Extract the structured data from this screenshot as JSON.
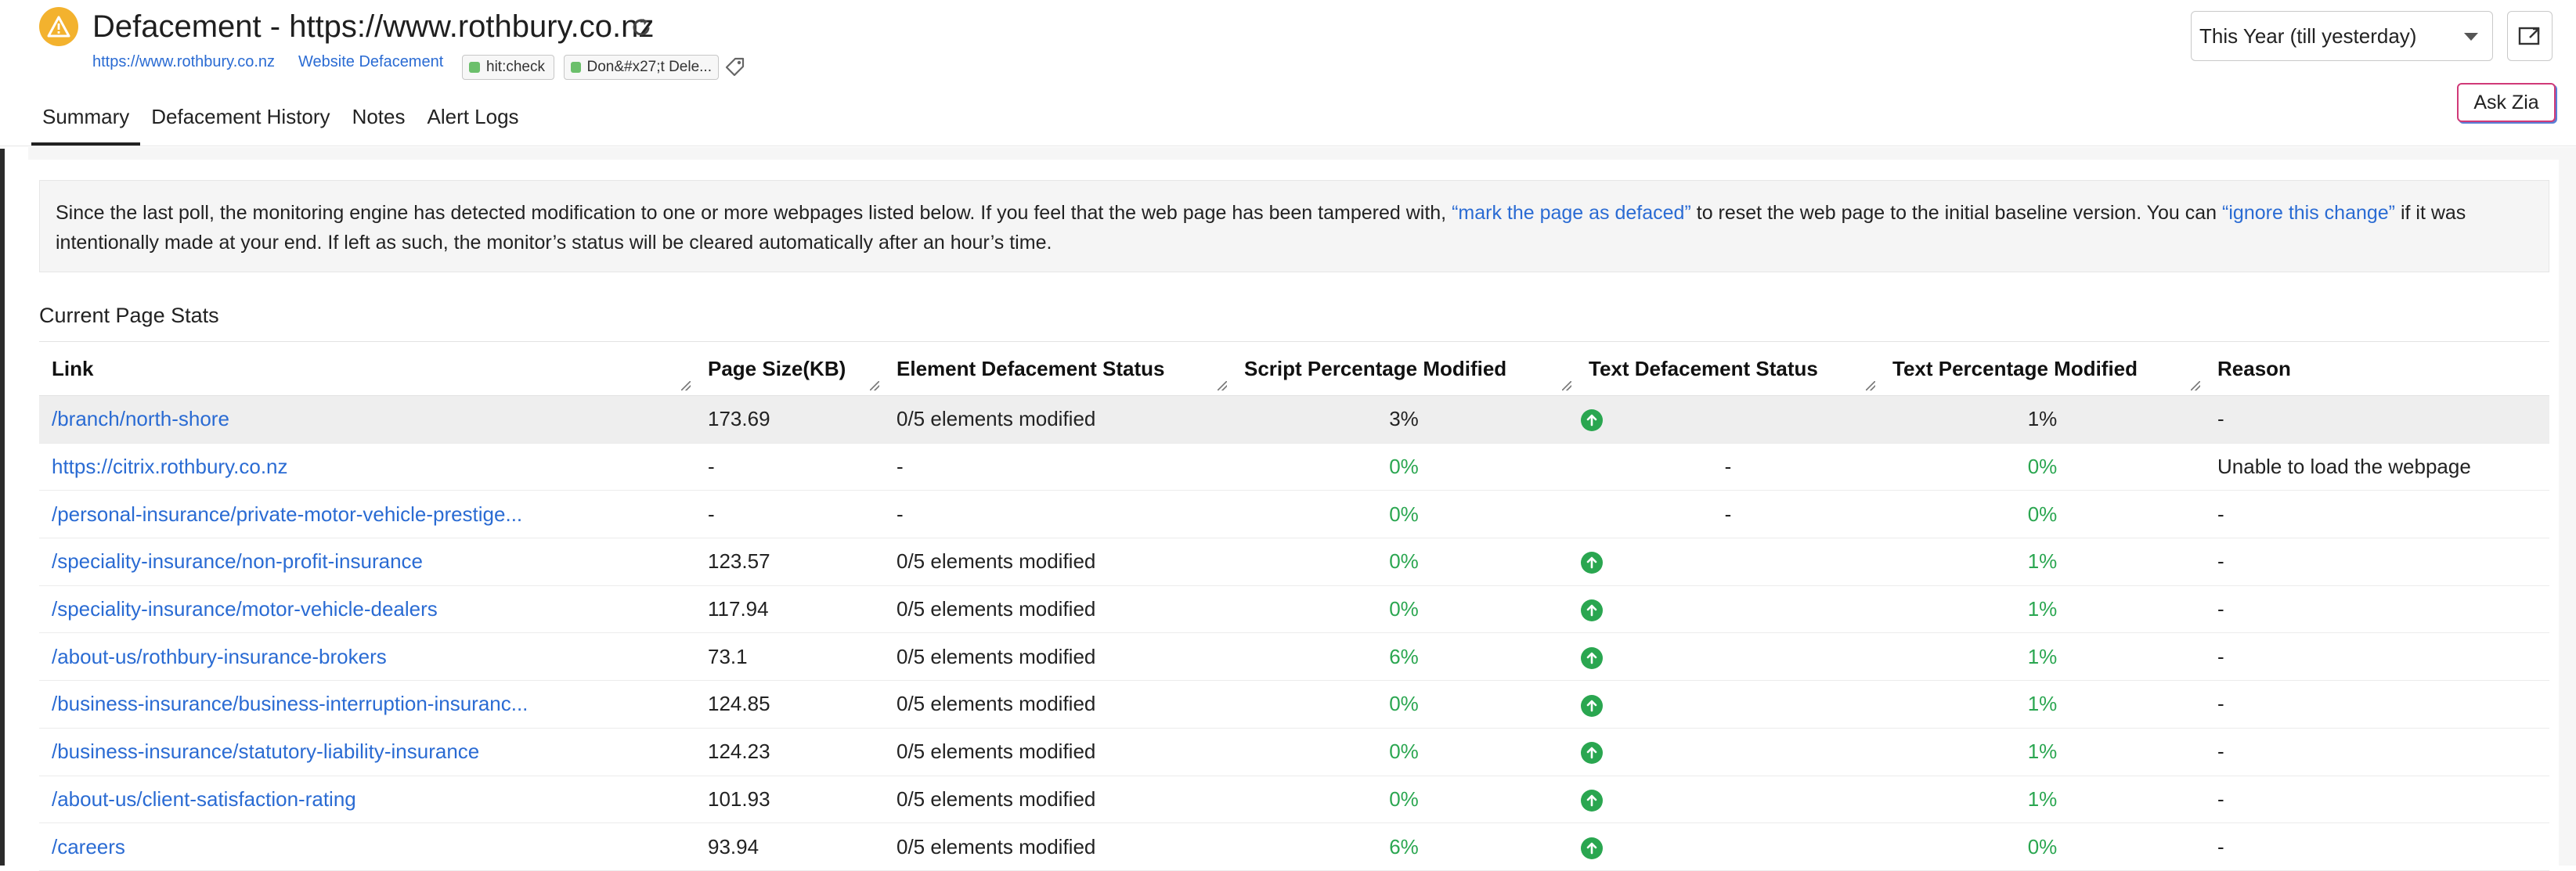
{
  "header": {
    "title": "Defacement - https://www.rothbury.co.nz",
    "url_link": "https://www.rothbury.co.nz",
    "type_link": "Website Defacement",
    "tags": [
      "hit:check",
      "Don&#x27;t Dele..."
    ]
  },
  "tabs": [
    {
      "label": "Summary"
    },
    {
      "label": "Defacement History"
    },
    {
      "label": "Notes"
    },
    {
      "label": "Alert Logs"
    }
  ],
  "controls": {
    "period": "This Year (till yesterday)",
    "ask_zia": "Ask Zia"
  },
  "notice": {
    "part1": "Since the last poll, the monitoring engine has detected modification to one or more webpages listed below. If you feel that the web page has been tampered with, ",
    "link1": "“mark the page as defaced”",
    "part2": " to reset the web page to the initial baseline version. You can ",
    "link2": "“ignore this change”",
    "part3": " if it was intentionally made at your end. If left as such, the monitor’s status will be cleared automatically after an hour’s time."
  },
  "section_title": "Current Page Stats",
  "table": {
    "columns": [
      "Link",
      "Page Size(KB)",
      "Element Defacement Status",
      "Script Percentage Modified",
      "Text Defacement Status",
      "Text Percentage Modified",
      "Reason"
    ],
    "rows": [
      {
        "link": "/branch/north-shore",
        "size": "173.69",
        "element": "0/5 elements modified",
        "script": "3%",
        "text_status": "up",
        "text_pct": "1%",
        "reason": "-"
      },
      {
        "link": "https://citrix.rothbury.co.nz",
        "size": "-",
        "element": "-",
        "script": "0%",
        "text_status": "-",
        "text_pct": "0%",
        "reason": "Unable to load the webpage"
      },
      {
        "link": "/personal-insurance/private-motor-vehicle-prestige...",
        "size": "-",
        "element": "-",
        "script": "0%",
        "text_status": "-",
        "text_pct": "0%",
        "reason": "-"
      },
      {
        "link": "/speciality-insurance/non-profit-insurance",
        "size": "123.57",
        "element": "0/5 elements modified",
        "script": "0%",
        "text_status": "up",
        "text_pct": "1%",
        "reason": "-"
      },
      {
        "link": "/speciality-insurance/motor-vehicle-dealers",
        "size": "117.94",
        "element": "0/5 elements modified",
        "script": "0%",
        "text_status": "up",
        "text_pct": "1%",
        "reason": "-"
      },
      {
        "link": "/about-us/rothbury-insurance-brokers",
        "size": "73.1",
        "element": "0/5 elements modified",
        "script": "6%",
        "text_status": "up",
        "text_pct": "1%",
        "reason": "-"
      },
      {
        "link": "/business-insurance/business-interruption-insuranc...",
        "size": "124.85",
        "element": "0/5 elements modified",
        "script": "0%",
        "text_status": "up",
        "text_pct": "1%",
        "reason": "-"
      },
      {
        "link": "/business-insurance/statutory-liability-insurance",
        "size": "124.23",
        "element": "0/5 elements modified",
        "script": "0%",
        "text_status": "up",
        "text_pct": "1%",
        "reason": "-"
      },
      {
        "link": "/about-us/client-satisfaction-rating",
        "size": "101.93",
        "element": "0/5 elements modified",
        "script": "0%",
        "text_status": "up",
        "text_pct": "1%",
        "reason": "-"
      },
      {
        "link": "/careers",
        "size": "93.94",
        "element": "0/5 elements modified",
        "script": "6%",
        "text_status": "up",
        "text_pct": "0%",
        "reason": "-"
      }
    ]
  },
  "colors": {
    "link": "#2a6bd3",
    "green": "#2aa650",
    "warning": "#f3b22e",
    "zia_border": "#d03a78"
  }
}
